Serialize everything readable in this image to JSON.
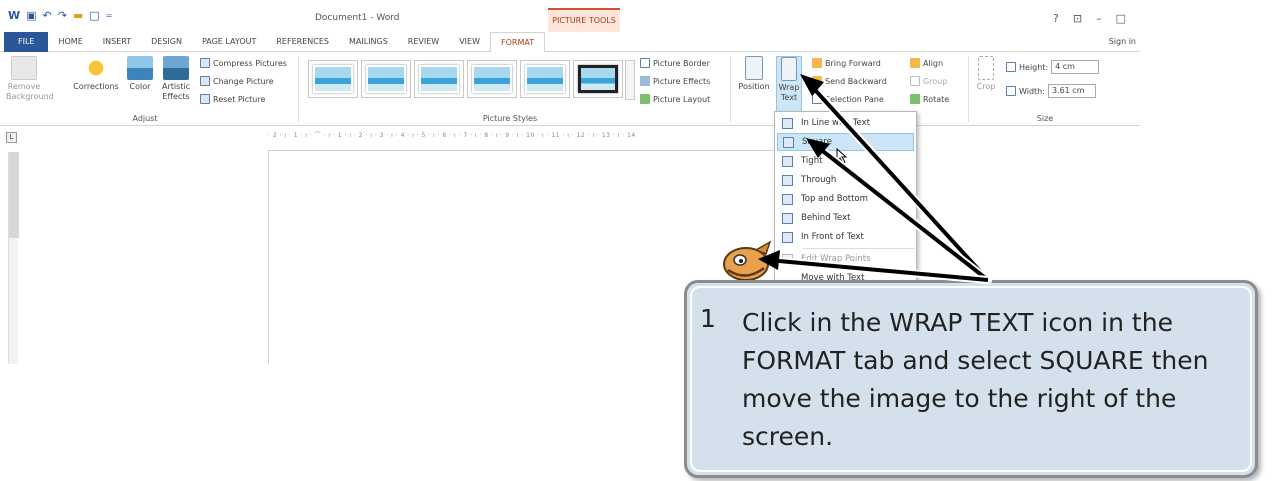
{
  "quick_access": {
    "file_glyph": "W",
    "save_glyph": "▣",
    "undo_glyph": "↶",
    "redo_glyph": "↷",
    "folder_glyph": "▬",
    "new_glyph": "□",
    "more_glyph": "="
  },
  "window": {
    "title": "Document1 - Word",
    "context_tools": "PICTURE TOOLS",
    "help": "?",
    "restore": "⊡",
    "minimize": "–",
    "maximize": "□"
  },
  "tabs": [
    "FILE",
    "HOME",
    "INSERT",
    "DESIGN",
    "PAGE LAYOUT",
    "REFERENCES",
    "MAILINGS",
    "REVIEW",
    "VIEW",
    "FORMAT"
  ],
  "signin": "Sign in",
  "ribbon": {
    "adjust": {
      "label": "Adjust",
      "remove_background": "Remove\nBackground",
      "corrections": "Corrections",
      "color": "Color",
      "artistic_effects": "Artistic\nEffects",
      "compress": "Compress Pictures",
      "change": "Change Picture",
      "reset": "Reset Picture"
    },
    "picture_styles": {
      "label": "Picture Styles",
      "border": "Picture Border",
      "effects": "Picture Effects",
      "layout": "Picture Layout"
    },
    "arrange": {
      "position": "Position",
      "wrap_text": "Wrap\nText",
      "bring_forward": "Bring Forward",
      "send_backward": "Send Backward",
      "selection_pane": "Selection Pane",
      "align": "Align",
      "group": "Group",
      "rotate": "Rotate"
    },
    "size": {
      "label": "Size",
      "crop": "Crop",
      "height_label": "Height:",
      "height_value": "4 cm",
      "width_label": "Width:",
      "width_value": "3.61 cm"
    }
  },
  "ruler": {
    "corner": "L",
    "ticks": "· 2 · ı · 1 · ı · ⌒ · ı · 1 · ı · 2 · ı · 3 · ı · 4 · ı · 5 · ı · 6 · ı · 7 · ı · 8 · ı · 9 · ı · 10 · ı · 11 · ı · 12 · ı · 13 · ı · 14"
  },
  "wrap_menu": [
    {
      "label": "In Line with Text",
      "highlighted": false
    },
    {
      "label": "Square",
      "highlighted": true
    },
    {
      "label": "Tight",
      "highlighted": false
    },
    {
      "label": "Through",
      "highlighted": false
    },
    {
      "label": "Top and Bottom",
      "highlighted": false
    },
    {
      "label": "Behind Text",
      "highlighted": false
    },
    {
      "label": "In Front of Text",
      "highlighted": false
    },
    {
      "label": "Edit Wrap Points",
      "highlighted": false
    },
    {
      "label": "Move with Text",
      "highlighted": false
    }
  ],
  "callout": {
    "number": "1",
    "text": "Click in the WRAP TEXT icon in the FORMAT tab and select SQUARE then move the image to the right of the screen."
  },
  "colors": {
    "word_blue": "#2b579a",
    "format_orange": "#b03a12",
    "callout_bg": "#d4e1ec",
    "menu_highlight": "#cde6f7"
  }
}
